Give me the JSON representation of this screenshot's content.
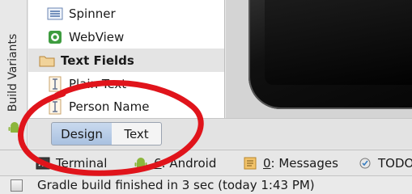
{
  "left_strip": {
    "build_variants_label": "Build Variants"
  },
  "palette": {
    "items": [
      {
        "label": "Spinner",
        "icon": "spinner-icon",
        "type": "widget"
      },
      {
        "label": "WebView",
        "icon": "webview-icon",
        "type": "widget"
      },
      {
        "label": "Text Fields",
        "icon": "folder-icon",
        "type": "group"
      },
      {
        "label": "Plain Text",
        "icon": "text-field-icon",
        "type": "widget"
      },
      {
        "label": "Person Name",
        "icon": "text-field-icon",
        "type": "widget"
      }
    ]
  },
  "editor_tabs": {
    "design": "Design",
    "text": "Text",
    "active": "Design"
  },
  "tool_windows": {
    "terminal": "Terminal",
    "android_prefix": "6",
    "android": ": Android",
    "messages_prefix": "0",
    "messages": ": Messages",
    "todo": "TODO"
  },
  "status": {
    "message": "Gradle build finished in 3 sec (today 1:43 PM)"
  },
  "colors": {
    "annotation": "#e0141b",
    "active_tab": "#b7cde8",
    "android_green": "#8cb63c"
  }
}
